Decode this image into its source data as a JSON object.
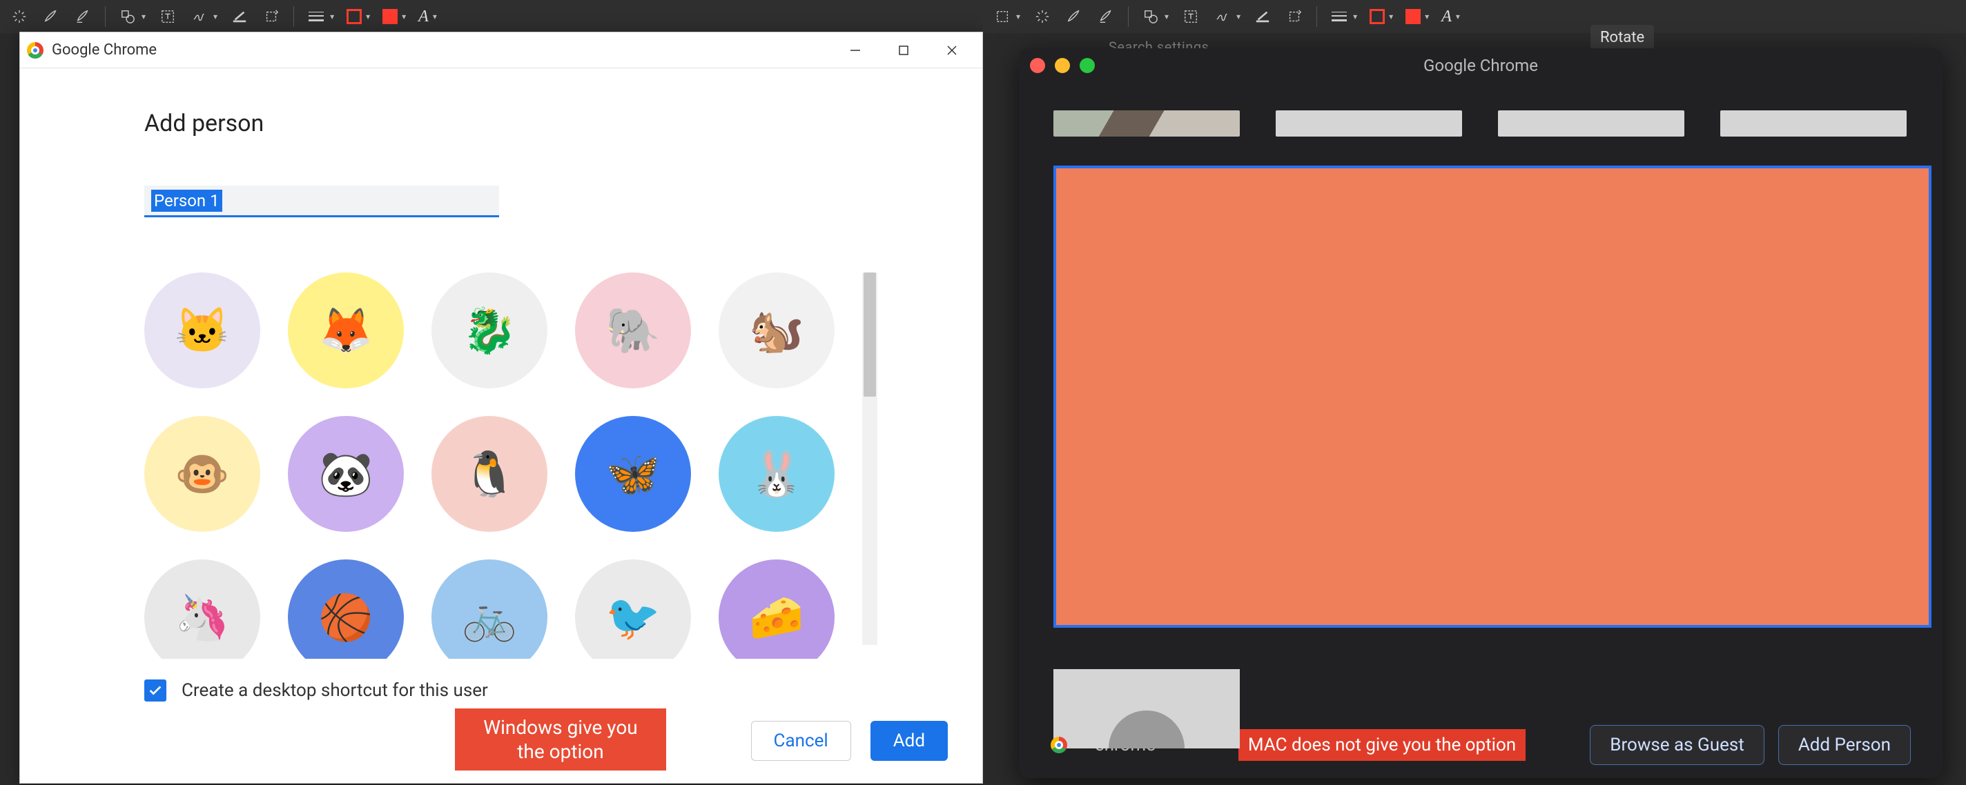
{
  "left": {
    "toolbar_icons": [
      "sparkle",
      "brush",
      "eraser",
      "shape",
      "text",
      "pen",
      "redact",
      "rotate",
      "line-weight",
      "stroke-swatch",
      "fill-swatch",
      "font"
    ],
    "window_title": "Google Chrome",
    "heading": "Add person",
    "name_value": "Person 1",
    "avatars": [
      {
        "name": "origami-cat",
        "bg": "av1"
      },
      {
        "name": "origami-fox",
        "bg": "av2"
      },
      {
        "name": "origami-dragon",
        "bg": "av3"
      },
      {
        "name": "origami-elephant",
        "bg": "av4"
      },
      {
        "name": "origami-squirrel",
        "bg": "av5"
      },
      {
        "name": "origami-monkey",
        "bg": "av6"
      },
      {
        "name": "origami-panda",
        "bg": "av7"
      },
      {
        "name": "origami-penguin",
        "bg": "av8"
      },
      {
        "name": "origami-butterfly",
        "bg": "av9"
      },
      {
        "name": "origami-rabbit",
        "bg": "av10"
      },
      {
        "name": "origami-unicorn",
        "bg": "av11"
      },
      {
        "name": "basketball",
        "bg": "av12"
      },
      {
        "name": "bicycle",
        "bg": "av13"
      },
      {
        "name": "bird",
        "bg": "av14"
      },
      {
        "name": "cheese",
        "bg": "av15"
      }
    ],
    "shortcut_checked": true,
    "shortcut_label": "Create a desktop shortcut for this user",
    "callout": "Windows give you\nthe option",
    "cancel_label": "Cancel",
    "add_label": "Add"
  },
  "right": {
    "toolbar_tooltip": "Rotate",
    "search_placeholder": "Search settings",
    "window_title": "Google Chrome",
    "chrome_brand": "chrome",
    "callout": "MAC does not give you the option",
    "guest_label": "Browse as Guest",
    "add_person_label": "Add Person"
  }
}
